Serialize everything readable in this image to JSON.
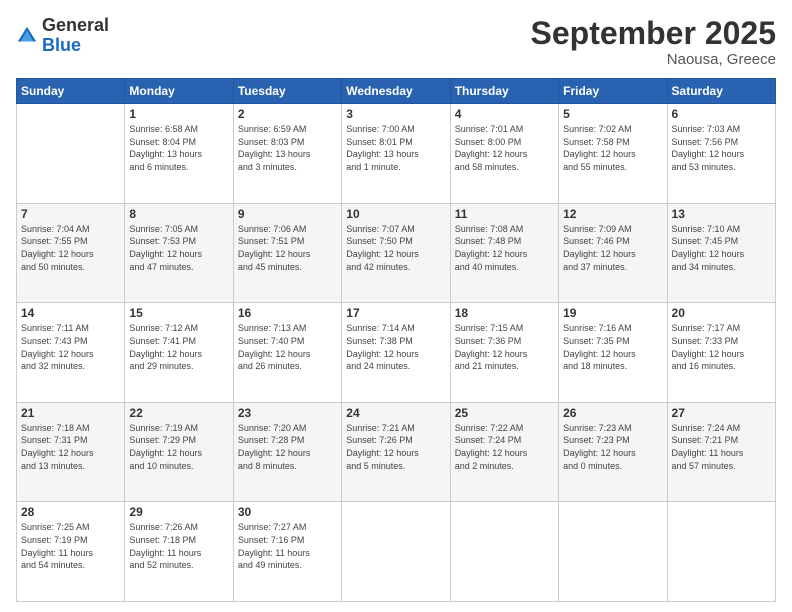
{
  "logo": {
    "general": "General",
    "blue": "Blue"
  },
  "title": {
    "month": "September 2025",
    "location": "Naousa, Greece"
  },
  "header": {
    "days": [
      "Sunday",
      "Monday",
      "Tuesday",
      "Wednesday",
      "Thursday",
      "Friday",
      "Saturday"
    ]
  },
  "weeks": [
    {
      "shaded": false,
      "days": [
        {
          "number": "",
          "info": ""
        },
        {
          "number": "1",
          "info": "Sunrise: 6:58 AM\nSunset: 8:04 PM\nDaylight: 13 hours\nand 6 minutes."
        },
        {
          "number": "2",
          "info": "Sunrise: 6:59 AM\nSunset: 8:03 PM\nDaylight: 13 hours\nand 3 minutes."
        },
        {
          "number": "3",
          "info": "Sunrise: 7:00 AM\nSunset: 8:01 PM\nDaylight: 13 hours\nand 1 minute."
        },
        {
          "number": "4",
          "info": "Sunrise: 7:01 AM\nSunset: 8:00 PM\nDaylight: 12 hours\nand 58 minutes."
        },
        {
          "number": "5",
          "info": "Sunrise: 7:02 AM\nSunset: 7:58 PM\nDaylight: 12 hours\nand 55 minutes."
        },
        {
          "number": "6",
          "info": "Sunrise: 7:03 AM\nSunset: 7:56 PM\nDaylight: 12 hours\nand 53 minutes."
        }
      ]
    },
    {
      "shaded": true,
      "days": [
        {
          "number": "7",
          "info": "Sunrise: 7:04 AM\nSunset: 7:55 PM\nDaylight: 12 hours\nand 50 minutes."
        },
        {
          "number": "8",
          "info": "Sunrise: 7:05 AM\nSunset: 7:53 PM\nDaylight: 12 hours\nand 47 minutes."
        },
        {
          "number": "9",
          "info": "Sunrise: 7:06 AM\nSunset: 7:51 PM\nDaylight: 12 hours\nand 45 minutes."
        },
        {
          "number": "10",
          "info": "Sunrise: 7:07 AM\nSunset: 7:50 PM\nDaylight: 12 hours\nand 42 minutes."
        },
        {
          "number": "11",
          "info": "Sunrise: 7:08 AM\nSunset: 7:48 PM\nDaylight: 12 hours\nand 40 minutes."
        },
        {
          "number": "12",
          "info": "Sunrise: 7:09 AM\nSunset: 7:46 PM\nDaylight: 12 hours\nand 37 minutes."
        },
        {
          "number": "13",
          "info": "Sunrise: 7:10 AM\nSunset: 7:45 PM\nDaylight: 12 hours\nand 34 minutes."
        }
      ]
    },
    {
      "shaded": false,
      "days": [
        {
          "number": "14",
          "info": "Sunrise: 7:11 AM\nSunset: 7:43 PM\nDaylight: 12 hours\nand 32 minutes."
        },
        {
          "number": "15",
          "info": "Sunrise: 7:12 AM\nSunset: 7:41 PM\nDaylight: 12 hours\nand 29 minutes."
        },
        {
          "number": "16",
          "info": "Sunrise: 7:13 AM\nSunset: 7:40 PM\nDaylight: 12 hours\nand 26 minutes."
        },
        {
          "number": "17",
          "info": "Sunrise: 7:14 AM\nSunset: 7:38 PM\nDaylight: 12 hours\nand 24 minutes."
        },
        {
          "number": "18",
          "info": "Sunrise: 7:15 AM\nSunset: 7:36 PM\nDaylight: 12 hours\nand 21 minutes."
        },
        {
          "number": "19",
          "info": "Sunrise: 7:16 AM\nSunset: 7:35 PM\nDaylight: 12 hours\nand 18 minutes."
        },
        {
          "number": "20",
          "info": "Sunrise: 7:17 AM\nSunset: 7:33 PM\nDaylight: 12 hours\nand 16 minutes."
        }
      ]
    },
    {
      "shaded": true,
      "days": [
        {
          "number": "21",
          "info": "Sunrise: 7:18 AM\nSunset: 7:31 PM\nDaylight: 12 hours\nand 13 minutes."
        },
        {
          "number": "22",
          "info": "Sunrise: 7:19 AM\nSunset: 7:29 PM\nDaylight: 12 hours\nand 10 minutes."
        },
        {
          "number": "23",
          "info": "Sunrise: 7:20 AM\nSunset: 7:28 PM\nDaylight: 12 hours\nand 8 minutes."
        },
        {
          "number": "24",
          "info": "Sunrise: 7:21 AM\nSunset: 7:26 PM\nDaylight: 12 hours\nand 5 minutes."
        },
        {
          "number": "25",
          "info": "Sunrise: 7:22 AM\nSunset: 7:24 PM\nDaylight: 12 hours\nand 2 minutes."
        },
        {
          "number": "26",
          "info": "Sunrise: 7:23 AM\nSunset: 7:23 PM\nDaylight: 12 hours\nand 0 minutes."
        },
        {
          "number": "27",
          "info": "Sunrise: 7:24 AM\nSunset: 7:21 PM\nDaylight: 11 hours\nand 57 minutes."
        }
      ]
    },
    {
      "shaded": false,
      "days": [
        {
          "number": "28",
          "info": "Sunrise: 7:25 AM\nSunset: 7:19 PM\nDaylight: 11 hours\nand 54 minutes."
        },
        {
          "number": "29",
          "info": "Sunrise: 7:26 AM\nSunset: 7:18 PM\nDaylight: 11 hours\nand 52 minutes."
        },
        {
          "number": "30",
          "info": "Sunrise: 7:27 AM\nSunset: 7:16 PM\nDaylight: 11 hours\nand 49 minutes."
        },
        {
          "number": "",
          "info": ""
        },
        {
          "number": "",
          "info": ""
        },
        {
          "number": "",
          "info": ""
        },
        {
          "number": "",
          "info": ""
        }
      ]
    }
  ]
}
